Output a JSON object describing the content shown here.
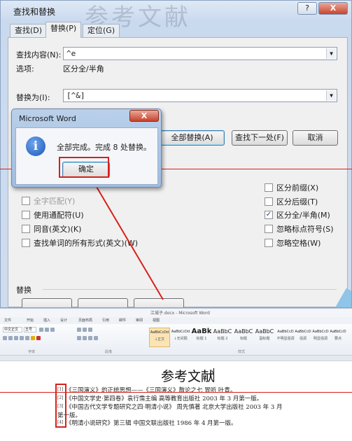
{
  "dialog": {
    "title": "查找和替换",
    "watermark": "参考文献",
    "help_button": "?",
    "close_button": "X",
    "tabs": [
      "查找(D)",
      "替换(P)",
      "定位(G)"
    ],
    "find_label": "查找内容(N):",
    "find_value": "^e",
    "options_label": "选项:",
    "options_value": "区分全/半角",
    "replace_label": "替换为(I):",
    "replace_value": "[^&]",
    "buttons": {
      "replace_all": "全部替换(A)",
      "find_next": "查找下一处(F)",
      "cancel": "取消"
    },
    "checkboxes_left": [
      {
        "label": "全字匹配(Y)",
        "checked": false,
        "disabled": true
      },
      {
        "label": "使用通配符(U)",
        "checked": false,
        "disabled": false
      },
      {
        "label": "同音(英文)(K)",
        "checked": false,
        "disabled": false
      },
      {
        "label": "查找单词的所有形式(英文)(W)",
        "checked": false,
        "disabled": false
      }
    ],
    "checkboxes_right": [
      {
        "label": "区分前缀(X)",
        "checked": false
      },
      {
        "label": "区分后缀(T)",
        "checked": false
      },
      {
        "label": "区分全/半角(M)",
        "checked": true
      },
      {
        "label": "忽略标点符号(S)",
        "checked": false
      },
      {
        "label": "忽略空格(W)",
        "checked": false
      }
    ],
    "section_replace": "替换"
  },
  "message_box": {
    "title": "Microsoft Word",
    "close": "X",
    "text": "全部完成。完成 8 处替换。",
    "ok_button": "确定"
  },
  "word": {
    "window_title": "江城子.docx - Microsoft Word",
    "tabs": [
      "文件",
      "开始",
      "插入",
      "设计",
      "页面布局",
      "引用",
      "邮件",
      "审阅",
      "视图"
    ],
    "font_name": "中文正文",
    "font_size": "五号",
    "styles": [
      {
        "sample": "AaBbCcDd",
        "name": "↓正文"
      },
      {
        "sample": "AaBbCcDd",
        "name": "↓无间隔"
      },
      {
        "sample": "AaBk",
        "name": "标题 1"
      },
      {
        "sample": "AaBbC",
        "name": "标题 2"
      },
      {
        "sample": "AaBbC",
        "name": "标题"
      },
      {
        "sample": "AaBbC",
        "name": "副标题"
      },
      {
        "sample": "AaBbCcD",
        "name": "不明显强调"
      },
      {
        "sample": "AaBbCcD",
        "name": "强调"
      },
      {
        "sample": "AaBbCcD",
        "name": "明显强调"
      },
      {
        "sample": "AaBbCcD",
        "name": "要点"
      }
    ],
    "group_labels": [
      "字体",
      "段落",
      "样式"
    ],
    "doc_title": "参考文献",
    "numbers": [
      "[1]",
      "[2]",
      "[3]",
      "[4]"
    ],
    "lines": [
      "《三国演义》的正统思想——《三国演义》散论之七   冒听  叶青。",
      "《中国文学史·第四卷》袁行霈主编   高等教育出版社     2003 年 3 月第一版。",
      "《中国古代文学专题研究之四·明清小说》 周先慎著  北京大学出版社   2003 年 3 月",
      "第一版。",
      "《明清小说研究》第三辑   中国文联出版社   1986 年 4 月第一版。"
    ]
  }
}
